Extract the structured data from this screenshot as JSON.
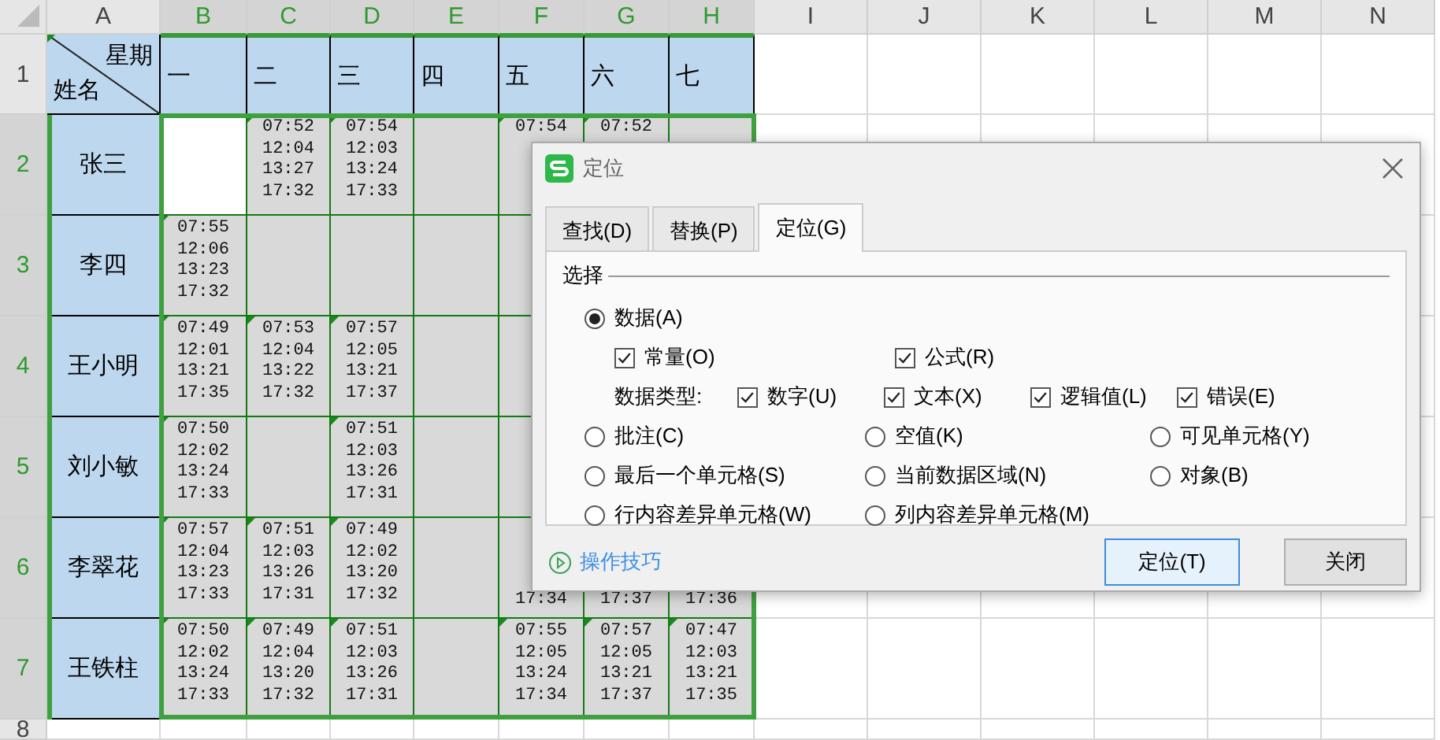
{
  "columns": [
    {
      "label": "A",
      "selected": false
    },
    {
      "label": "B",
      "selected": true
    },
    {
      "label": "C",
      "selected": true
    },
    {
      "label": "D",
      "selected": true
    },
    {
      "label": "E",
      "selected": true
    },
    {
      "label": "F",
      "selected": true
    },
    {
      "label": "G",
      "selected": true
    },
    {
      "label": "H",
      "selected": true
    },
    {
      "label": "I",
      "selected": false
    },
    {
      "label": "J",
      "selected": false
    },
    {
      "label": "K",
      "selected": false
    },
    {
      "label": "L",
      "selected": false
    },
    {
      "label": "M",
      "selected": false
    },
    {
      "label": "N",
      "selected": false
    }
  ],
  "header_row": {
    "row": "1",
    "selected": false,
    "corner_top": "星期",
    "corner_bottom": "姓名",
    "days": [
      "一",
      "二",
      "三",
      "四",
      "五",
      "六",
      "七"
    ]
  },
  "records": [
    {
      "row": "2",
      "selected": true,
      "name": "张三",
      "cells": [
        {
          "active": true
        },
        {
          "lines": [
            "07:52",
            "12:04",
            "13:27",
            "17:32"
          ],
          "active": false
        },
        {
          "lines": [
            "07:54",
            "12:03",
            "13:24",
            "17:33"
          ],
          "active": false
        },
        {
          "active": false
        },
        {
          "lines": [
            "07:54"
          ],
          "active": false
        },
        {
          "lines": [
            "07:52"
          ],
          "active": false
        },
        {
          "active": false
        }
      ]
    },
    {
      "row": "3",
      "selected": true,
      "name": "李四",
      "cells": [
        {
          "lines": [
            "07:55",
            "12:06",
            "13:23",
            "17:32"
          ],
          "active": false
        },
        {
          "active": false
        },
        {
          "active": false
        },
        {
          "active": false
        },
        {
          "active": false
        }
      ]
    },
    {
      "row": "4",
      "selected": true,
      "name": "王小明",
      "cells": [
        {
          "lines": [
            "07:49",
            "12:01",
            "13:21",
            "17:35"
          ],
          "active": false
        },
        {
          "lines": [
            "07:53",
            "12:04",
            "13:22",
            "17:32"
          ],
          "active": false
        },
        {
          "lines": [
            "07:57",
            "12:05",
            "13:21",
            "17:37"
          ],
          "active": false
        },
        {
          "active": false
        },
        {
          "active": false
        }
      ]
    },
    {
      "row": "5",
      "selected": true,
      "name": "刘小敏",
      "cells": [
        {
          "lines": [
            "07:50",
            "12:02",
            "13:24",
            "17:33"
          ],
          "active": false
        },
        {
          "active": false
        },
        {
          "lines": [
            "07:51",
            "12:03",
            "13:26",
            "17:31"
          ],
          "active": false
        },
        {
          "active": false
        },
        {
          "active": false
        }
      ]
    },
    {
      "row": "6",
      "selected": true,
      "name": "李翠花",
      "cells": [
        {
          "lines": [
            "07:57",
            "12:04",
            "13:23",
            "17:33"
          ],
          "active": false
        },
        {
          "lines": [
            "07:51",
            "12:03",
            "13:26",
            "17:31"
          ],
          "active": false
        },
        {
          "lines": [
            "07:49",
            "12:02",
            "13:20",
            "17:32"
          ],
          "active": false
        },
        {
          "active": false
        },
        {
          "kind": "tail",
          "lines": [
            "17:34"
          ],
          "active": false
        },
        {
          "kind": "tail",
          "lines": [
            "17:37"
          ],
          "active": false
        },
        {
          "kind": "tail",
          "lines": [
            "17:36"
          ],
          "active": false
        }
      ]
    },
    {
      "row": "7",
      "selected": true,
      "name": "王铁柱",
      "cells": [
        {
          "lines": [
            "07:50",
            "12:02",
            "13:24",
            "17:33"
          ],
          "active": false
        },
        {
          "lines": [
            "07:49",
            "12:04",
            "13:20",
            "17:32"
          ],
          "active": false
        },
        {
          "lines": [
            "07:51",
            "12:03",
            "13:26",
            "17:31"
          ],
          "active": false
        },
        {
          "active": false
        },
        {
          "lines": [
            "07:55",
            "12:05",
            "13:24",
            "17:34"
          ],
          "active": false
        },
        {
          "lines": [
            "07:57",
            "12:05",
            "13:21",
            "17:37"
          ],
          "active": false
        },
        {
          "lines": [
            "07:47",
            "12:03",
            "13:21",
            "17:35"
          ],
          "active": false
        }
      ]
    }
  ],
  "last_row": "8",
  "dialog": {
    "title": "定位",
    "tabs": [
      {
        "label": "查找(D)",
        "selected": false
      },
      {
        "label": "替换(P)",
        "selected": false
      },
      {
        "label": "定位(G)",
        "selected": true
      }
    ],
    "group": "选择",
    "radios": [
      {
        "label": "数据(A)",
        "selected": true
      },
      {
        "label": "批注(C)",
        "selected": false
      },
      {
        "label": "空值(K)",
        "selected": false
      },
      {
        "label": "可见单元格(Y)",
        "selected": false
      },
      {
        "label": "最后一个单元格(S)",
        "selected": false
      },
      {
        "label": "当前数据区域(N)",
        "selected": false
      },
      {
        "label": "对象(B)",
        "selected": false
      },
      {
        "label": "行内容差异单元格(W)",
        "selected": false
      },
      {
        "label": "列内容差异单元格(M)",
        "selected": false
      }
    ],
    "data_checks": [
      {
        "label": "常量(O)",
        "checked": true
      },
      {
        "label": "公式(R)",
        "checked": true
      }
    ],
    "type_label": "数据类型:",
    "type_checks": [
      {
        "label": "数字(U)",
        "checked": true
      },
      {
        "label": "文本(X)",
        "checked": true
      },
      {
        "label": "逻辑值(L)",
        "checked": true
      },
      {
        "label": "错误(E)",
        "checked": true
      }
    ],
    "tips_link": "操作技巧",
    "buttons": [
      "定位(T)",
      "关闭"
    ]
  }
}
